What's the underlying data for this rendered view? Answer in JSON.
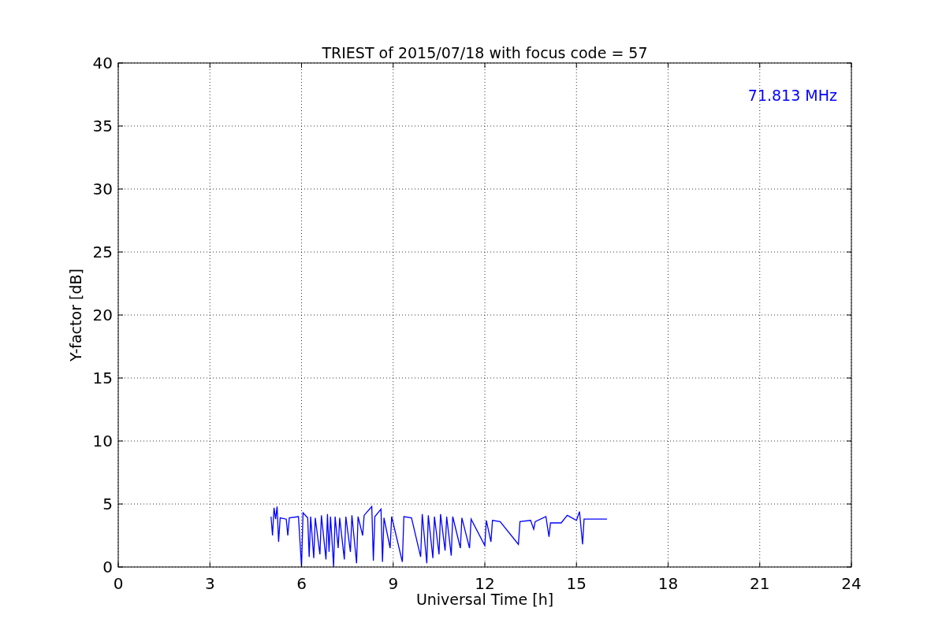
{
  "chart_data": {
    "type": "line",
    "title": "TRIEST of 2015/07/18 with focus code = 57",
    "xlabel": "Universal Time [h]",
    "ylabel": "Y-factor [dB]",
    "xlim": [
      0,
      24
    ],
    "ylim": [
      0,
      40
    ],
    "xticks": [
      0,
      3,
      6,
      9,
      12,
      15,
      18,
      21,
      24
    ],
    "yticks": [
      0,
      5,
      10,
      15,
      20,
      25,
      30,
      35,
      40
    ],
    "series": [
      {
        "name": "71.813 MHz",
        "color": "#0000ff",
        "x": [
          5.0,
          5.05,
          5.1,
          5.15,
          5.2,
          5.25,
          5.3,
          5.5,
          5.55,
          5.6,
          5.9,
          6.0,
          6.05,
          6.2,
          6.25,
          6.3,
          6.4,
          6.45,
          6.6,
          6.65,
          6.8,
          6.85,
          6.9,
          6.95,
          7.05,
          7.1,
          7.2,
          7.25,
          7.4,
          7.45,
          7.6,
          7.65,
          7.8,
          7.85,
          8.0,
          8.05,
          8.3,
          8.35,
          8.4,
          8.6,
          8.65,
          8.7,
          8.9,
          8.95,
          9.3,
          9.35,
          9.6,
          9.9,
          9.95,
          10.1,
          10.15,
          10.3,
          10.35,
          10.5,
          10.55,
          10.7,
          10.75,
          10.9,
          10.95,
          11.2,
          11.25,
          11.5,
          11.55,
          12.0,
          12.05,
          12.2,
          12.25,
          12.5,
          13.1,
          13.15,
          13.5,
          13.6,
          13.65,
          14.0,
          14.1,
          14.15,
          14.5,
          14.7,
          15.0,
          15.1,
          15.2,
          15.25,
          15.5,
          16.0
        ],
        "values": [
          4.0,
          2.5,
          4.7,
          3.8,
          4.8,
          2.0,
          3.9,
          3.8,
          2.5,
          3.9,
          4.0,
          0.0,
          4.3,
          3.9,
          0.8,
          4.0,
          0.7,
          3.9,
          1.0,
          4.1,
          0.6,
          4.2,
          1.2,
          4.0,
          0.0,
          4.0,
          1.5,
          3.9,
          0.6,
          4.0,
          1.2,
          4.1,
          0.3,
          4.0,
          2.5,
          4.1,
          4.8,
          0.5,
          4.0,
          4.6,
          0.4,
          3.9,
          1.5,
          4.0,
          0.4,
          4.0,
          3.9,
          0.8,
          4.2,
          0.3,
          4.1,
          0.7,
          4.0,
          1.0,
          4.2,
          1.3,
          4.0,
          0.9,
          4.0,
          1.5,
          3.9,
          1.5,
          3.8,
          1.7,
          3.7,
          2.0,
          3.7,
          3.6,
          1.8,
          3.6,
          3.7,
          3.0,
          3.6,
          4.0,
          2.4,
          3.5,
          3.5,
          4.1,
          3.7,
          4.4,
          1.8,
          3.8,
          3.8,
          3.8
        ]
      }
    ],
    "grid": true
  }
}
